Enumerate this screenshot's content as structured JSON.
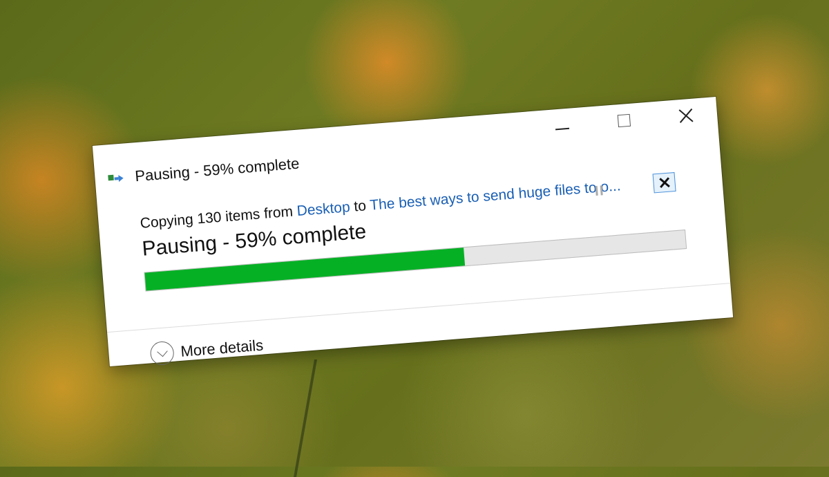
{
  "window": {
    "title": "Pausing - 59% complete",
    "controls": {
      "minimize_icon": "minimize-icon",
      "maximize_icon": "maximize-icon",
      "close_icon": "close-icon"
    }
  },
  "copy": {
    "prefix": "Copying 130 items from ",
    "source": "Desktop",
    "middle": " to ",
    "destination": "The best ways to send huge files to o..."
  },
  "status": {
    "text": "Pausing - 59% complete",
    "progress_percent": 59
  },
  "footer": {
    "more_details_label": "More details"
  },
  "colors": {
    "progress_fill": "#06b025",
    "link": "#1a5fb4"
  }
}
